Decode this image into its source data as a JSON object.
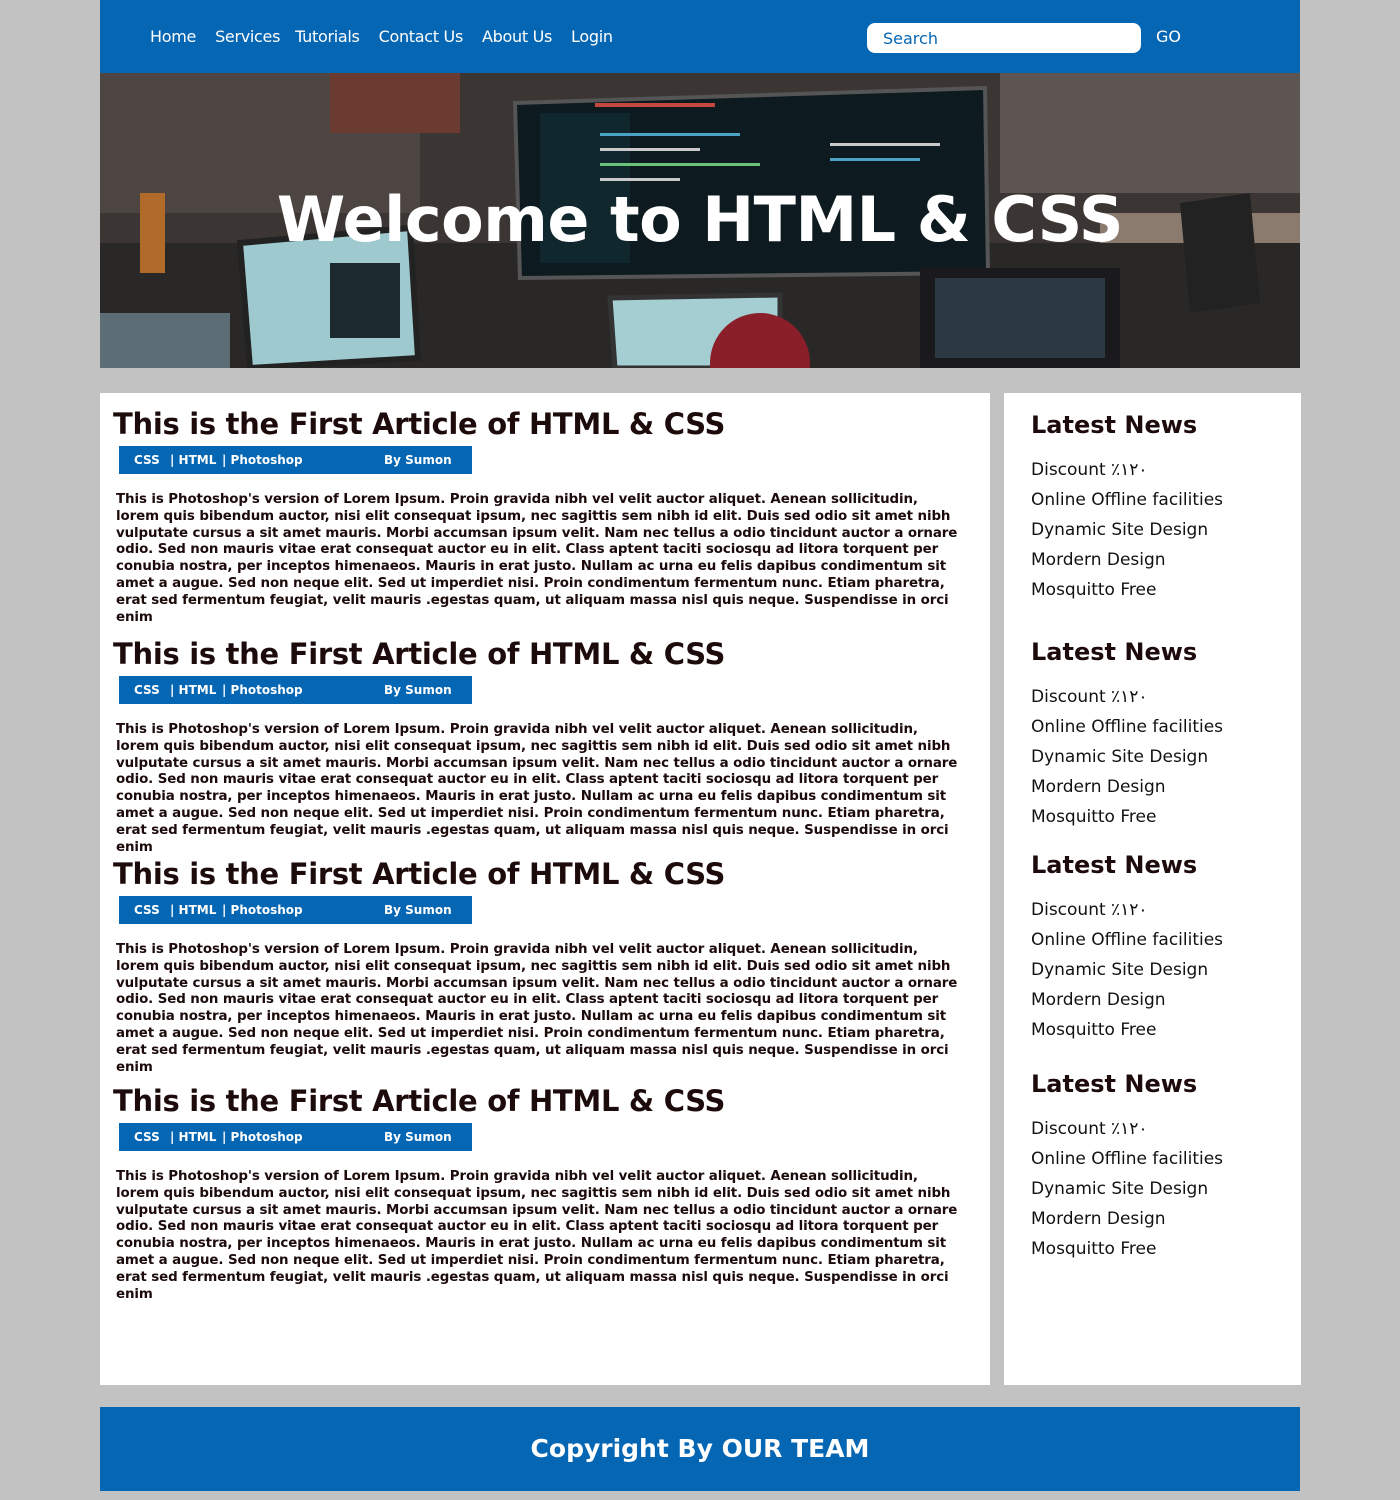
{
  "nav": {
    "items": [
      "Home",
      "Services",
      "Tutorials",
      "Contact Us",
      "About Us",
      "Login"
    ],
    "search_placeholder": "Search",
    "go_label": "GO"
  },
  "hero": {
    "title": "Welcome to HTML & CSS"
  },
  "articles": [
    {
      "title": "This is the First Article of HTML & CSS",
      "tags": [
        "CSS",
        "| HTML",
        "| Photoshop"
      ],
      "author": "By Sumon",
      "body": "This is Photoshop's version  of Lorem Ipsum. Proin gravida nibh vel velit auctor aliquet. Aenean sollicitudin, lorem quis bibendum auctor, nisi elit consequat ipsum, nec sagittis sem nibh id elit. Duis sed odio sit amet nibh vulputate cursus a sit amet mauris. Morbi accumsan ipsum velit. Nam nec tellus a odio tincidunt auctor a ornare odio. Sed non  mauris vitae erat consequat auctor eu in elit. Class aptent taciti sociosqu ad litora torquent per conubia nostra, per inceptos himenaeos. Mauris in erat justo. Nullam ac urna eu felis dapibus condimentum sit amet a augue. Sed non neque elit. Sed ut imperdiet nisi. Proin condimentum fermentum nunc. Etiam pharetra, erat sed fermentum feugiat, velit mauris .egestas quam, ut aliquam massa nisl quis neque. Suspendisse in orci enim"
    },
    {
      "title": "This is the First Article of HTML & CSS",
      "tags": [
        "CSS",
        "| HTML",
        "| Photoshop"
      ],
      "author": "By Sumon",
      "body": "This is Photoshop's version  of Lorem Ipsum. Proin gravida nibh vel velit auctor aliquet. Aenean sollicitudin, lorem quis bibendum auctor, nisi elit consequat ipsum, nec sagittis sem nibh id elit. Duis sed odio sit amet nibh vulputate cursus a sit amet mauris. Morbi accumsan ipsum velit. Nam nec tellus a odio tincidunt auctor a ornare odio. Sed non  mauris vitae erat consequat auctor eu in elit. Class aptent taciti sociosqu ad litora torquent per conubia nostra, per inceptos himenaeos. Mauris in erat justo. Nullam ac urna eu felis dapibus condimentum sit amet a augue. Sed non neque elit. Sed ut imperdiet nisi. Proin condimentum fermentum nunc. Etiam pharetra, erat sed fermentum feugiat, velit mauris .egestas quam, ut aliquam massa nisl quis neque. Suspendisse in orci enim"
    },
    {
      "title": "This is the First Article of HTML & CSS",
      "tags": [
        "CSS",
        "| HTML",
        "| Photoshop"
      ],
      "author": "By Sumon",
      "body": "This is Photoshop's version  of Lorem Ipsum. Proin gravida nibh vel velit auctor aliquet. Aenean sollicitudin, lorem quis bibendum auctor, nisi elit consequat ipsum, nec sagittis sem nibh id elit. Duis sed odio sit amet nibh vulputate cursus a sit amet mauris. Morbi accumsan ipsum velit. Nam nec tellus a odio tincidunt auctor a ornare odio. Sed non  mauris vitae erat consequat auctor eu in elit. Class aptent taciti sociosqu ad litora torquent per conubia nostra, per inceptos himenaeos. Mauris in erat justo. Nullam ac urna eu felis dapibus condimentum sit amet a augue. Sed non neque elit. Sed ut imperdiet nisi. Proin condimentum fermentum nunc. Etiam pharetra, erat sed fermentum feugiat, velit mauris .egestas quam, ut aliquam massa nisl quis neque. Suspendisse in orci enim"
    },
    {
      "title": "This is the First Article of HTML & CSS",
      "tags": [
        "CSS",
        "| HTML",
        "| Photoshop"
      ],
      "author": "By Sumon",
      "body": "This is Photoshop's version  of Lorem Ipsum. Proin gravida nibh vel velit auctor aliquet. Aenean sollicitudin, lorem quis bibendum auctor, nisi elit consequat ipsum, nec sagittis sem nibh id elit. Duis sed odio sit amet nibh vulputate cursus a sit amet mauris. Morbi accumsan ipsum velit. Nam nec tellus a odio tincidunt auctor a ornare odio. Sed non  mauris vitae erat consequat auctor eu in elit. Class aptent taciti sociosqu ad litora torquent per conubia nostra, per inceptos himenaeos. Mauris in erat justo. Nullam ac urna eu felis dapibus condimentum sit amet a augue. Sed non neque elit. Sed ut imperdiet nisi. Proin condimentum fermentum nunc. Etiam pharetra, erat sed fermentum feugiat, velit mauris .egestas quam, ut aliquam massa nisl quis neque. Suspendisse in orci enim"
    }
  ],
  "sidebar": [
    {
      "heading": "Latest News",
      "items": [
        "Discount ٪١٢٠",
        "Online Offline facilities",
        "Dynamic Site Design",
        "Mordern Design",
        "Mosquitto Free"
      ]
    },
    {
      "heading": "Latest News",
      "items": [
        "Discount ٪١٢٠",
        "Online Offline facilities",
        "Dynamic Site Design",
        "Mordern Design",
        "Mosquitto Free"
      ]
    },
    {
      "heading": "Latest News",
      "items": [
        "Discount ٪١٢٠",
        "Online Offline facilities",
        "Dynamic Site Design",
        "Mordern Design",
        "Mosquitto Free"
      ]
    },
    {
      "heading": "Latest News",
      "items": [
        "Discount ٪١٢٠",
        "Online Offline facilities",
        "Dynamic Site Design",
        "Mordern Design",
        "Mosquitto Free"
      ]
    }
  ],
  "footer": {
    "text": "Copyright By OUR TEAM"
  },
  "colors": {
    "brand_blue": "#0566b3",
    "page_bg": "#c2c2c2",
    "heading_text": "#1d0b0b"
  }
}
